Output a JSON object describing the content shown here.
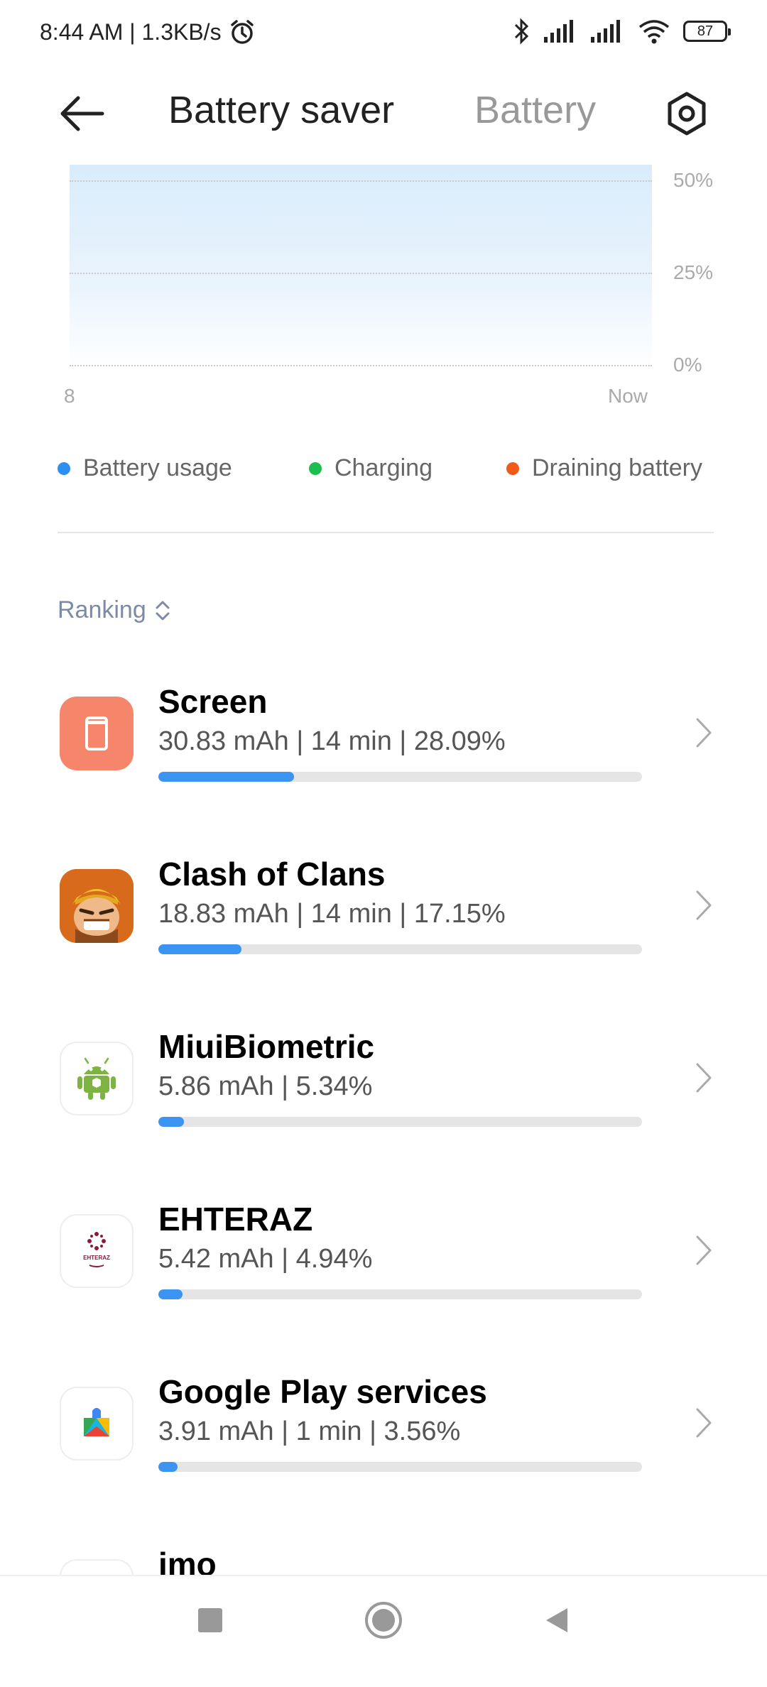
{
  "status_bar": {
    "time_speed": "8:44 AM | 1.3KB/s",
    "battery_level": "87"
  },
  "header": {
    "title": "Battery saver",
    "tab_battery": "Battery"
  },
  "chart_data": {
    "type": "area",
    "y_ticks": [
      "50%",
      "25%",
      "0%"
    ],
    "x_ticks": [
      "8",
      "Now"
    ],
    "ylim": [
      0,
      50
    ],
    "grid": true
  },
  "legend": [
    {
      "label": "Battery usage",
      "color": "#2f8ff0"
    },
    {
      "label": "Charging",
      "color": "#1ebd4f"
    },
    {
      "label": "Draining battery",
      "color": "#f25a1a"
    }
  ],
  "ranking_label": "Ranking",
  "apps": [
    {
      "name": "Screen",
      "stats": "30.83 mAh | 14 min  | 28.09%",
      "percent": 28.09
    },
    {
      "name": "Clash of Clans",
      "stats": "18.83 mAh | 14 min  | 17.15%",
      "percent": 17.15
    },
    {
      "name": "MiuiBiometric",
      "stats": "5.86 mAh | 5.34%",
      "percent": 5.34
    },
    {
      "name": "EHTERAZ",
      "stats": "5.42 mAh | 4.94%",
      "percent": 4.94
    },
    {
      "name": "Google Play services",
      "stats": "3.91 mAh | 1 min  | 3.56%",
      "percent": 3.56
    },
    {
      "name": "imo",
      "stats": "",
      "percent": 0
    }
  ],
  "colors": {
    "accent": "#3b93f2",
    "screen_icon_bg": "#f5866c"
  },
  "icon_text": {
    "ehteraz_logo": "EHTERAZ"
  }
}
